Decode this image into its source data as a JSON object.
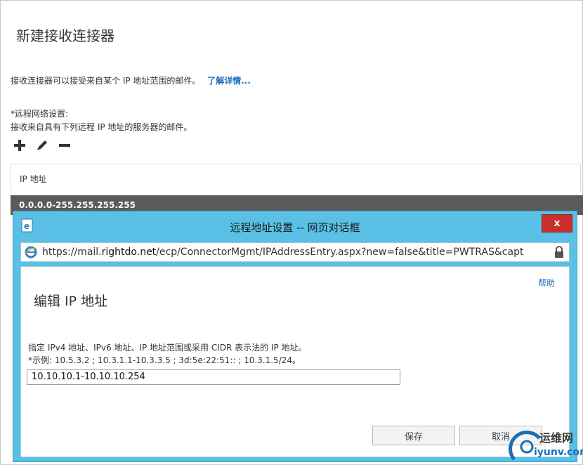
{
  "page": {
    "title": "新建接收连接器",
    "intro_text": "接收连接器可以接受来自某个 IP 地址范围的邮件。",
    "learn_more": "了解详情...",
    "remote_label": "*远程网络设置:",
    "remote_desc": "接收来自具有下列远程 IP 地址的服务器的邮件。"
  },
  "toolbar": {
    "add": "add-icon",
    "edit": "edit-icon",
    "remove": "remove-icon"
  },
  "table": {
    "header": "IP 地址",
    "rows": [
      "0.0.0.0-255.255.255.255"
    ]
  },
  "dialog": {
    "title": "远程地址设置 -- 网页对话框",
    "close_label": "x",
    "url_scheme": "https://mail.",
    "url_host": "rightdo.net",
    "url_path": "/ecp/ConnectorMgmt/IPAddressEntry.aspx?new=false&title=PWTRAS&capt",
    "help": "帮助",
    "heading": "编辑 IP 地址",
    "description": "指定 IPv4 地址、IPv6 地址、IP 地址范围或采用 CIDR 表示法的 IP 地址。",
    "example": "*示例: 10.5.3.2 ; 10.3.1.1-10.3.3.5 ; 3d:5e:22:51:: ; 10.3.1.5/24。",
    "ip_value": "10.10.10.1-10.10.10.254",
    "save": "保存",
    "cancel": "取消"
  },
  "watermark": {
    "line1": "运维网",
    "line2": "iyunv.com"
  },
  "colors": {
    "dialog_frame": "#5bc0e5",
    "selected_row": "#5a5a5a",
    "link": "#1f6fbf",
    "close_button": "#c9302c"
  }
}
